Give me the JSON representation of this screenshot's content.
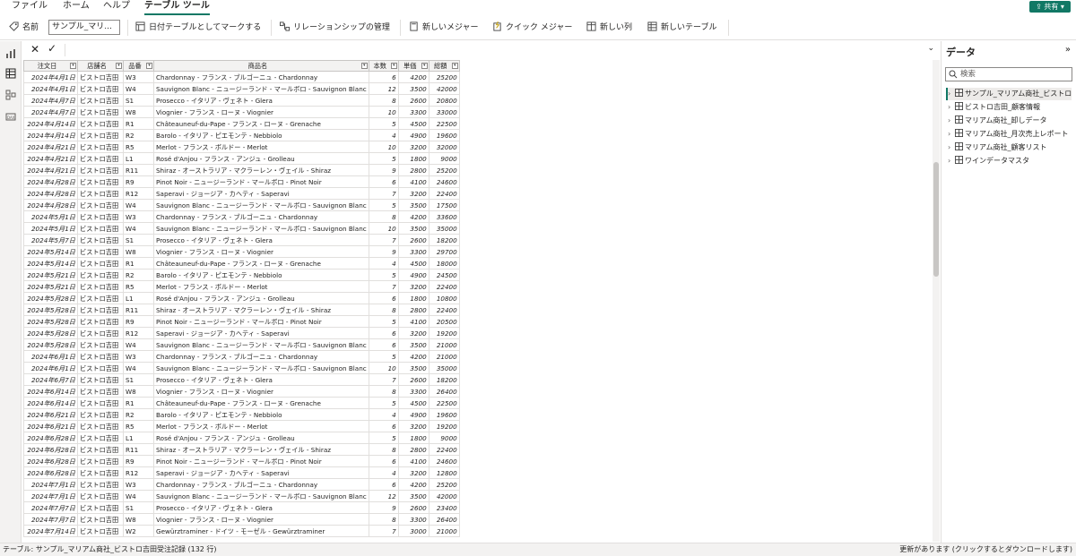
{
  "menu": {
    "items": [
      "ファイル",
      "ホーム",
      "ヘルプ",
      "テーブル ツール"
    ],
    "share_label": "共有"
  },
  "ribbon": {
    "name_label": "名前",
    "name_value": "サンプル_マリ...",
    "mark_date_table": "日付テーブルとしてマークする",
    "manage_relationships": "リレーションシップの管理",
    "new_measure": "新しいメジャー",
    "quick_measure": "クイック メジャー",
    "new_column": "新しい列",
    "new_table": "新しいテーブル"
  },
  "table": {
    "columns": [
      "注文日",
      "店舗名",
      "品番",
      "商品名",
      "本数",
      "単価",
      "総額"
    ],
    "rows": [
      [
        "2024年4月1日",
        "ビストロ吉田",
        "W3",
        "Chardonnay - フランス - ブルゴーニュ - Chardonnay",
        "6",
        "4200",
        "25200"
      ],
      [
        "2024年4月1日",
        "ビストロ吉田",
        "W4",
        "Sauvignon Blanc - ニュージーランド - マールボロ - Sauvignon Blanc",
        "12",
        "3500",
        "42000"
      ],
      [
        "2024年4月7日",
        "ビストロ吉田",
        "S1",
        "Prosecco - イタリア - ヴェネト - Glera",
        "8",
        "2600",
        "20800"
      ],
      [
        "2024年4月7日",
        "ビストロ吉田",
        "W8",
        "Viognier - フランス - ローヌ - Viognier",
        "10",
        "3300",
        "33000"
      ],
      [
        "2024年4月14日",
        "ビストロ吉田",
        "R1",
        "Châteauneuf-du-Pape - フランス - ローヌ - Grenache",
        "5",
        "4500",
        "22500"
      ],
      [
        "2024年4月14日",
        "ビストロ吉田",
        "R2",
        "Barolo - イタリア - ピエモンテ - Nebbiolo",
        "4",
        "4900",
        "19600"
      ],
      [
        "2024年4月21日",
        "ビストロ吉田",
        "R5",
        "Merlot - フランス - ボルドー - Merlot",
        "10",
        "3200",
        "32000"
      ],
      [
        "2024年4月21日",
        "ビストロ吉田",
        "L1",
        "Rosé d'Anjou - フランス - アンジュ - Grolleau",
        "5",
        "1800",
        "9000"
      ],
      [
        "2024年4月21日",
        "ビストロ吉田",
        "R11",
        "Shiraz - オーストラリア - マクラーレン・ヴェイル - Shiraz",
        "9",
        "2800",
        "25200"
      ],
      [
        "2024年4月28日",
        "ビストロ吉田",
        "R9",
        "Pinot Noir - ニュージーランド - マールボロ - Pinot Noir",
        "6",
        "4100",
        "24600"
      ],
      [
        "2024年4月28日",
        "ビストロ吉田",
        "R12",
        "Saperavi - ジョージア - カヘティ - Saperavi",
        "7",
        "3200",
        "22400"
      ],
      [
        "2024年4月28日",
        "ビストロ吉田",
        "W4",
        "Sauvignon Blanc - ニュージーランド - マールボロ - Sauvignon Blanc",
        "5",
        "3500",
        "17500"
      ],
      [
        "2024年5月1日",
        "ビストロ吉田",
        "W3",
        "Chardonnay - フランス - ブルゴーニュ - Chardonnay",
        "8",
        "4200",
        "33600"
      ],
      [
        "2024年5月1日",
        "ビストロ吉田",
        "W4",
        "Sauvignon Blanc - ニュージーランド - マールボロ - Sauvignon Blanc",
        "10",
        "3500",
        "35000"
      ],
      [
        "2024年5月7日",
        "ビストロ吉田",
        "S1",
        "Prosecco - イタリア - ヴェネト - Glera",
        "7",
        "2600",
        "18200"
      ],
      [
        "2024年5月14日",
        "ビストロ吉田",
        "W8",
        "Viognier - フランス - ローヌ - Viognier",
        "9",
        "3300",
        "29700"
      ],
      [
        "2024年5月14日",
        "ビストロ吉田",
        "R1",
        "Châteauneuf-du-Pape - フランス - ローヌ - Grenache",
        "4",
        "4500",
        "18000"
      ],
      [
        "2024年5月21日",
        "ビストロ吉田",
        "R2",
        "Barolo - イタリア - ピエモンテ - Nebbiolo",
        "5",
        "4900",
        "24500"
      ],
      [
        "2024年5月21日",
        "ビストロ吉田",
        "R5",
        "Merlot - フランス - ボルドー - Merlot",
        "7",
        "3200",
        "22400"
      ],
      [
        "2024年5月28日",
        "ビストロ吉田",
        "L1",
        "Rosé d'Anjou - フランス - アンジュ - Grolleau",
        "6",
        "1800",
        "10800"
      ],
      [
        "2024年5月28日",
        "ビストロ吉田",
        "R11",
        "Shiraz - オーストラリア - マクラーレン・ヴェイル - Shiraz",
        "8",
        "2800",
        "22400"
      ],
      [
        "2024年5月28日",
        "ビストロ吉田",
        "R9",
        "Pinot Noir - ニュージーランド - マールボロ - Pinot Noir",
        "5",
        "4100",
        "20500"
      ],
      [
        "2024年5月28日",
        "ビストロ吉田",
        "R12",
        "Saperavi - ジョージア - カヘティ - Saperavi",
        "6",
        "3200",
        "19200"
      ],
      [
        "2024年5月28日",
        "ビストロ吉田",
        "W4",
        "Sauvignon Blanc - ニュージーランド - マールボロ - Sauvignon Blanc",
        "6",
        "3500",
        "21000"
      ],
      [
        "2024年6月1日",
        "ビストロ吉田",
        "W3",
        "Chardonnay - フランス - ブルゴーニュ - Chardonnay",
        "5",
        "4200",
        "21000"
      ],
      [
        "2024年6月1日",
        "ビストロ吉田",
        "W4",
        "Sauvignon Blanc - ニュージーランド - マールボロ - Sauvignon Blanc",
        "10",
        "3500",
        "35000"
      ],
      [
        "2024年6月7日",
        "ビストロ吉田",
        "S1",
        "Prosecco - イタリア - ヴェネト - Glera",
        "7",
        "2600",
        "18200"
      ],
      [
        "2024年6月14日",
        "ビストロ吉田",
        "W8",
        "Viognier - フランス - ローヌ - Viognier",
        "8",
        "3300",
        "26400"
      ],
      [
        "2024年6月14日",
        "ビストロ吉田",
        "R1",
        "Châteauneuf-du-Pape - フランス - ローヌ - Grenache",
        "5",
        "4500",
        "22500"
      ],
      [
        "2024年6月21日",
        "ビストロ吉田",
        "R2",
        "Barolo - イタリア - ピエモンテ - Nebbiolo",
        "4",
        "4900",
        "19600"
      ],
      [
        "2024年6月21日",
        "ビストロ吉田",
        "R5",
        "Merlot - フランス - ボルドー - Merlot",
        "6",
        "3200",
        "19200"
      ],
      [
        "2024年6月28日",
        "ビストロ吉田",
        "L1",
        "Rosé d'Anjou - フランス - アンジュ - Grolleau",
        "5",
        "1800",
        "9000"
      ],
      [
        "2024年6月28日",
        "ビストロ吉田",
        "R11",
        "Shiraz - オーストラリア - マクラーレン・ヴェイル - Shiraz",
        "8",
        "2800",
        "22400"
      ],
      [
        "2024年6月28日",
        "ビストロ吉田",
        "R9",
        "Pinot Noir - ニュージーランド - マールボロ - Pinot Noir",
        "6",
        "4100",
        "24600"
      ],
      [
        "2024年6月28日",
        "ビストロ吉田",
        "R12",
        "Saperavi - ジョージア - カヘティ - Saperavi",
        "4",
        "3200",
        "12800"
      ],
      [
        "2024年7月1日",
        "ビストロ吉田",
        "W3",
        "Chardonnay - フランス - ブルゴーニュ - Chardonnay",
        "6",
        "4200",
        "25200"
      ],
      [
        "2024年7月1日",
        "ビストロ吉田",
        "W4",
        "Sauvignon Blanc - ニュージーランド - マールボロ - Sauvignon Blanc",
        "12",
        "3500",
        "42000"
      ],
      [
        "2024年7月7日",
        "ビストロ吉田",
        "S1",
        "Prosecco - イタリア - ヴェネト - Glera",
        "9",
        "2600",
        "23400"
      ],
      [
        "2024年7月7日",
        "ビストロ吉田",
        "W8",
        "Viognier - フランス - ローヌ - Viognier",
        "8",
        "3300",
        "26400"
      ],
      [
        "2024年7月14日",
        "ビストロ吉田",
        "W2",
        "Gewürztraminer - ドイツ - モーゼル - Gewürztraminer",
        "7",
        "3000",
        "21000"
      ]
    ]
  },
  "data_pane": {
    "title": "データ",
    "search_placeholder": "検索",
    "tables": [
      "サンプル_マリアム商社_ビストロ...",
      "ビストロ吉田_顧客情報",
      "マリアム商社_卸しデータ",
      "マリアム商社_月次売上レポート",
      "マリアム商社_顧客リスト",
      "ワインデータマスタ"
    ]
  },
  "status": {
    "left": "テーブル: サンプル_マリアム商社_ビストロ吉田受注記録 (132 行)",
    "right": "更新があります (クリックするとダウンロードします)"
  },
  "colors": {
    "accent": "#117865"
  }
}
